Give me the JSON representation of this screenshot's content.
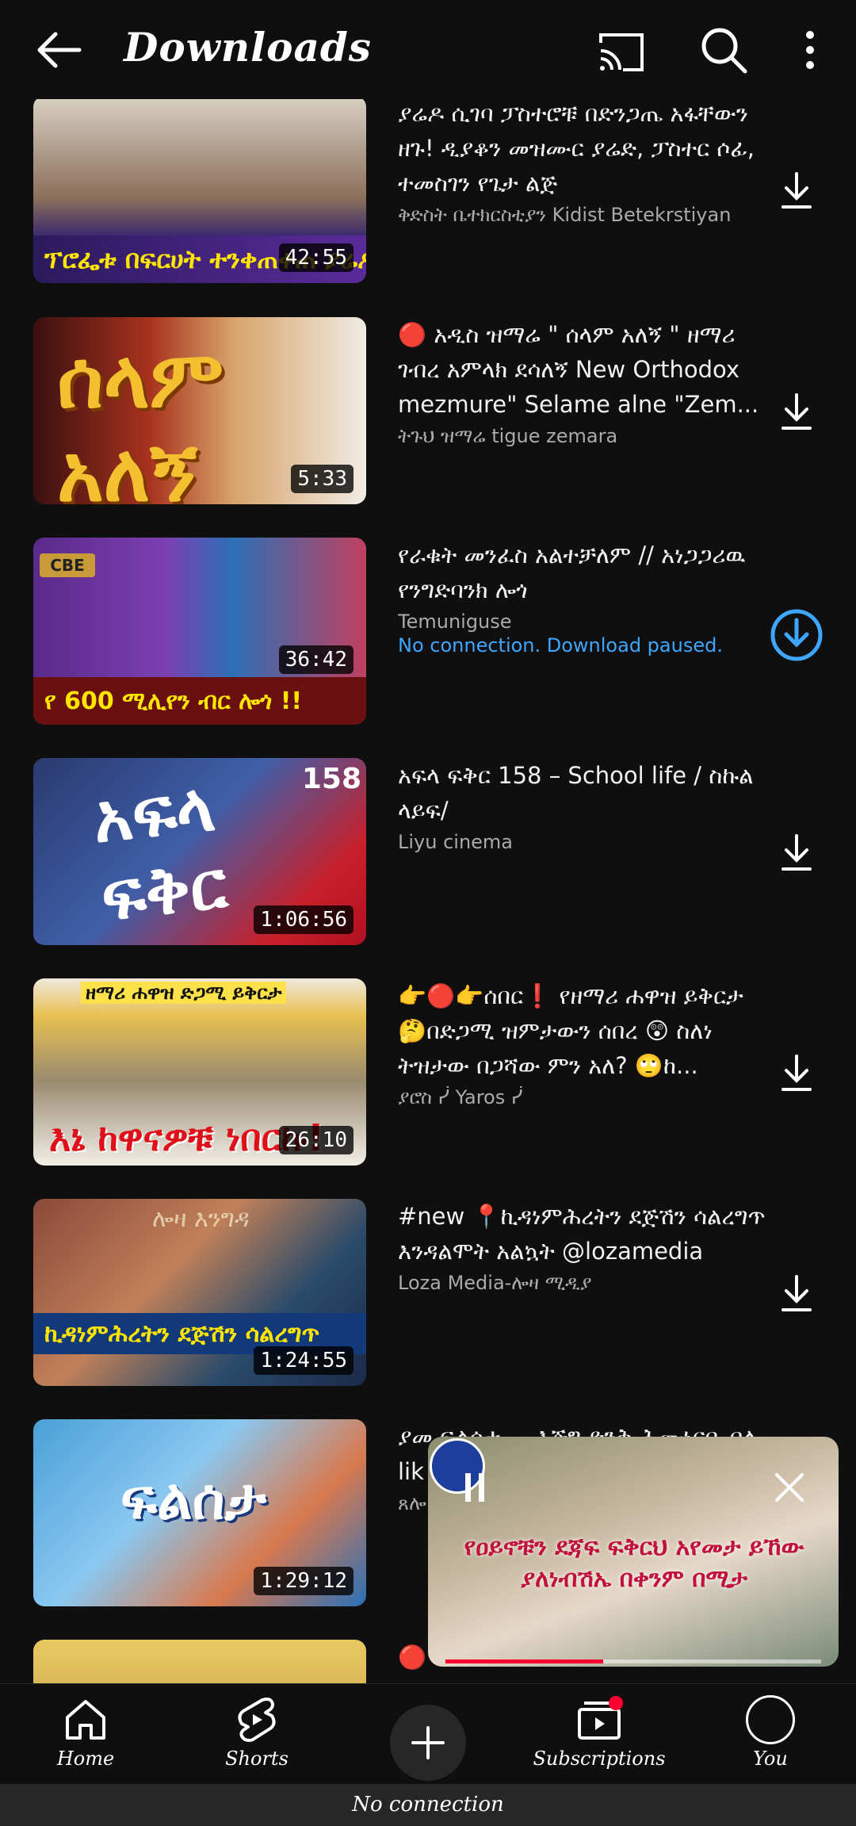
{
  "header": {
    "title": "Downloads"
  },
  "videos": [
    {
      "title": "ያሬዶ ሲገባ ፓስተሮቹ በድንጋጤ አፋቸውን ዘጉ! ዲያቆን መዝሙር ያሬድ, ፓስተር ሶፊ, ተመስገን የጌታ ልጅ",
      "channel": "ቅድስት ቤተክርስቲያን Kidist Betekrstiyan",
      "duration": "42:55",
      "thumb_text": "ፕሮፌቱ በፍርሀት ተንቀጠቀጠ ያሬዶ ዛሬም በገባበት አለ"
    },
    {
      "title": "🔴 አዲስ ዝማሬ \" ሰላም አለኝ \" ዘማሪ ገብረ አምላክ ደሳለኝ New Orthodox mezmure\" Selame alne \"Zem...",
      "channel": "ትጉህ ዝማሬ tigue zemara",
      "duration": "5:33",
      "thumb_text": "ሰላም አለኝ"
    },
    {
      "title": "የራቁት መንፈስ አልተቻለም // አነጋጋሪዉ የንግድባንክ ሎጎ",
      "channel": "Temuniguse",
      "status": "No connection. Download paused.",
      "duration": "36:42",
      "thumb_text": "የ 600 ሚሊየን ብር ሎጎ !!",
      "thumb_logo": "CBE"
    },
    {
      "title": "አፍላ ፍቅር 158 – School life / ስኩል ላይፍ/",
      "channel": "Liyu cinema",
      "duration": "1:06:56",
      "thumb_text": "አፍላ ፍቅር",
      "thumb_num": "158"
    },
    {
      "title": "👉🔴👉ሰበር❗ የዘማሪ ሐዋዝ ይቅርታ 🤔በድጋሚ ዝምታውን ሰበረ 😲 ስለነ ትዝታው በጋሻው ምን አለ? 🙄ከ...",
      "channel": "ያሮስ ᓰ Yaros ᓰ",
      "duration": "26:10",
      "thumb_text": "እኔ ከዋናዎቹ ነበርኩ!",
      "thumb_top": "ዘማሪ ሐዋዝ ድጋሚ ይቅርታ"
    },
    {
      "title": "#new 📍ኪዳነምሕረትን ደጅሽን ሳልረግጥ እንዳልሞት አልኳት @lozamedia",
      "channel": "Loza Media-ሎዛ ሚዲያ",
      "duration": "1:24:55",
      "thumb_text": "ኪዳነምሕረትን ደጅሽን ሳልረግጥ",
      "thumb_top": "ሎዛ እንግዳ"
    },
    {
      "title": "ያመ ፍልሰታ ... እጅግ ድንቅ ሕሙኔርቤ በለ lik",
      "channel": "ጸሎ",
      "duration": "1:29:12",
      "thumb_text": "ፍልሰታ"
    },
    {
      "title": "🔴"
    }
  ],
  "miniplayer": {
    "caption": "የዐይኖቹን ደጃፍ ፍቅርህ አየመታ ይኸው ያለነብሽኤ በቀንም በሚታ",
    "progress": 0.42
  },
  "nav": {
    "items": [
      {
        "label": "Home"
      },
      {
        "label": "Shorts"
      },
      {
        "label": "Subscriptions"
      },
      {
        "label": "You"
      }
    ]
  },
  "status_bar": {
    "text": "No connection"
  },
  "colors": {
    "background": "#0f0f0f",
    "accent_blue": "#3ea6ff",
    "brand_red": "#ff0033",
    "text_secondary": "#aaaaaa"
  }
}
